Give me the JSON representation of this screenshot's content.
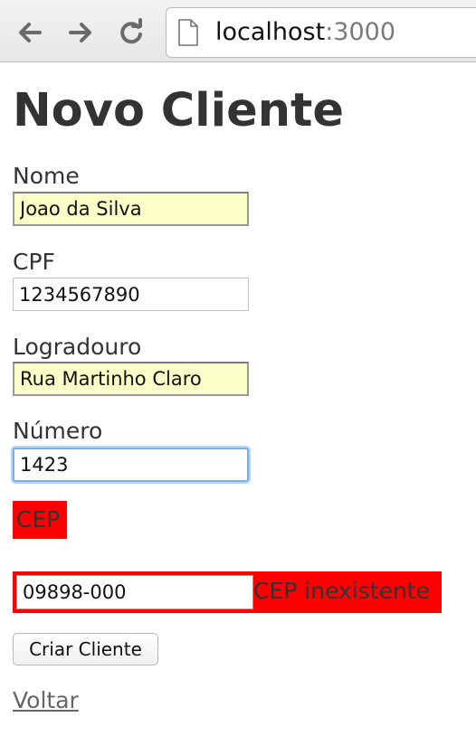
{
  "browser": {
    "url_host": "localhost",
    "url_port": ":3000",
    "icons": {
      "back": "arrow-left-icon",
      "forward": "arrow-right-icon",
      "reload": "reload-icon",
      "page": "page-icon"
    }
  },
  "page": {
    "title": "Novo Cliente",
    "fields": {
      "nome": {
        "label": "Nome",
        "value": "Joao da Silva"
      },
      "cpf": {
        "label": "CPF",
        "value": "1234567890"
      },
      "logradouro": {
        "label": "Logradouro",
        "value": "Rua Martinho Claro"
      },
      "numero": {
        "label": "Número",
        "value": "1423"
      },
      "cep": {
        "label": "CEP",
        "value": "09898-000",
        "error": "CEP inexistente"
      }
    },
    "submit_label": "Criar Cliente",
    "back_link": "Voltar",
    "colors": {
      "error_bg": "#ff0000",
      "autofill_bg": "#fbffc8",
      "focus_ring": "#78aef5"
    }
  }
}
